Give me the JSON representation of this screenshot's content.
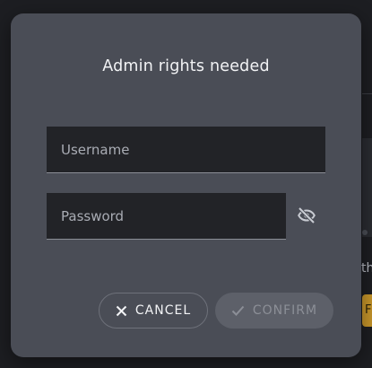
{
  "dialog": {
    "title": "Admin rights needed",
    "username": {
      "placeholder": "Username",
      "value": ""
    },
    "password": {
      "placeholder": "Password",
      "value": "",
      "visibility_icon": "eye-off-icon"
    },
    "buttons": {
      "cancel": {
        "label": "CANCEL",
        "icon": "close-icon"
      },
      "confirm": {
        "label": "CONFIRM",
        "icon": "check-icon",
        "disabled": true
      }
    }
  },
  "background": {
    "partial_text": "th",
    "partial_button_text": "F",
    "accent_color": "#c8962a"
  }
}
